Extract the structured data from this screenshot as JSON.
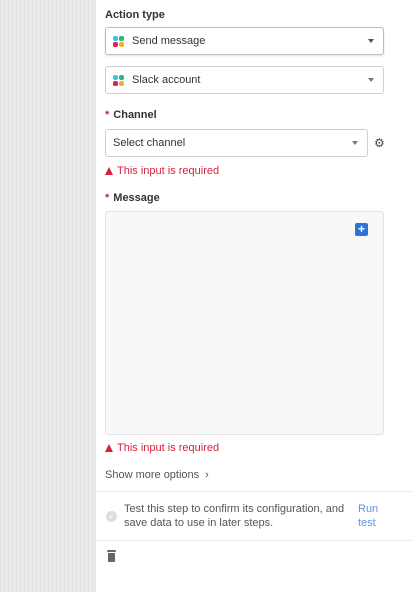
{
  "action_type": {
    "label": "Action type",
    "value": "Send message",
    "icon": "slack-icon"
  },
  "account": {
    "value": "Slack account",
    "icon": "slack-icon"
  },
  "channel": {
    "required_mark": "*",
    "label": "Channel",
    "placeholder": "Select channel",
    "error": "This input is required"
  },
  "message": {
    "required_mark": "*",
    "label": "Message",
    "insert_icon": "+",
    "error": "This input is required"
  },
  "show_more": {
    "label": "Show more options",
    "chevron": "›"
  },
  "test_step": {
    "check_icon": "✓",
    "text": "Test this step to confirm its configuration, and save data to use in later steps.",
    "run_label": "Run test"
  },
  "colors": {
    "error": "#d8213b",
    "link": "#5a9ad8",
    "insert_button": "#2f72d8",
    "slack_blue": "#36c5f0",
    "slack_green": "#2eb67d",
    "slack_yellow": "#ecb22e",
    "slack_red": "#e01e5a"
  }
}
